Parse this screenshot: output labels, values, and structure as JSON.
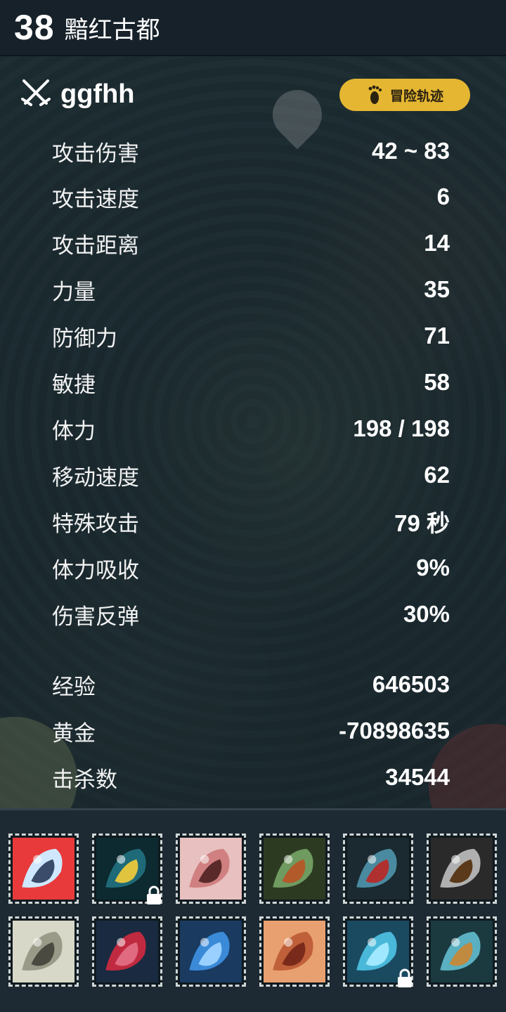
{
  "header": {
    "level": "38",
    "location": "黯红古都"
  },
  "character": {
    "name": "ggfhh",
    "adventure_button": "冒险轨迹"
  },
  "stats": [
    {
      "label": "攻击伤害",
      "value": "42 ~ 83"
    },
    {
      "label": "攻击速度",
      "value": "6"
    },
    {
      "label": "攻击距离",
      "value": "14"
    },
    {
      "label": "力量",
      "value": "35"
    },
    {
      "label": "防御力",
      "value": "71"
    },
    {
      "label": "敏捷",
      "value": "58"
    },
    {
      "label": "体力",
      "value": "198 / 198"
    },
    {
      "label": "移动速度",
      "value": "62"
    },
    {
      "label": "特殊攻击",
      "value": "79 秒"
    },
    {
      "label": "体力吸收",
      "value": "9%"
    },
    {
      "label": "伤害反弹",
      "value": "30%"
    }
  ],
  "totals": [
    {
      "label": "经验",
      "value": "646503"
    },
    {
      "label": "黄金",
      "value": "-70898635"
    },
    {
      "label": "击杀数",
      "value": "34544"
    }
  ],
  "inventory": {
    "slots": [
      {
        "name": "hat-item-icon",
        "locked": false,
        "colors": [
          "#cfe8ff",
          "#3a4c6a",
          "#e83a3a"
        ]
      },
      {
        "name": "scythe-item-icon",
        "locked": true,
        "colors": [
          "#1f6a78",
          "#e0c440",
          "#0c2a30"
        ]
      },
      {
        "name": "pickaxe-item-icon",
        "locked": false,
        "colors": [
          "#d08080",
          "#5a2a2a",
          "#e8c0c0"
        ]
      },
      {
        "name": "herb-item-icon",
        "locked": false,
        "colors": [
          "#6f9a60",
          "#b35a2a",
          "#2d3a22"
        ]
      },
      {
        "name": "armor-item-icon",
        "locked": false,
        "colors": [
          "#4a8aa0",
          "#b03030",
          "#1a2a30"
        ]
      },
      {
        "name": "gauntlet-item-icon",
        "locked": false,
        "colors": [
          "#b0b0b0",
          "#5a3a1a",
          "#2a2a2a"
        ]
      },
      {
        "name": "glove-item-icon",
        "locked": false,
        "colors": [
          "#9a9a88",
          "#4a4a40",
          "#d8d8c8"
        ]
      },
      {
        "name": "coral-item-icon",
        "locked": false,
        "colors": [
          "#c02a40",
          "#e06a80",
          "#1a2a40"
        ]
      },
      {
        "name": "slime-item-icon",
        "locked": false,
        "colors": [
          "#3a8ad8",
          "#9ad0ff",
          "#1a3a60"
        ]
      },
      {
        "name": "scroll-item-icon",
        "locked": false,
        "colors": [
          "#c0603a",
          "#7a2a1a",
          "#e8a070"
        ]
      },
      {
        "name": "crystal-item-icon",
        "locked": true,
        "colors": [
          "#4ab8d8",
          "#a0e8ff",
          "#1a4a60"
        ]
      },
      {
        "name": "bow-item-icon",
        "locked": false,
        "colors": [
          "#5ab0c0",
          "#c08a40",
          "#1a3a40"
        ]
      }
    ]
  }
}
